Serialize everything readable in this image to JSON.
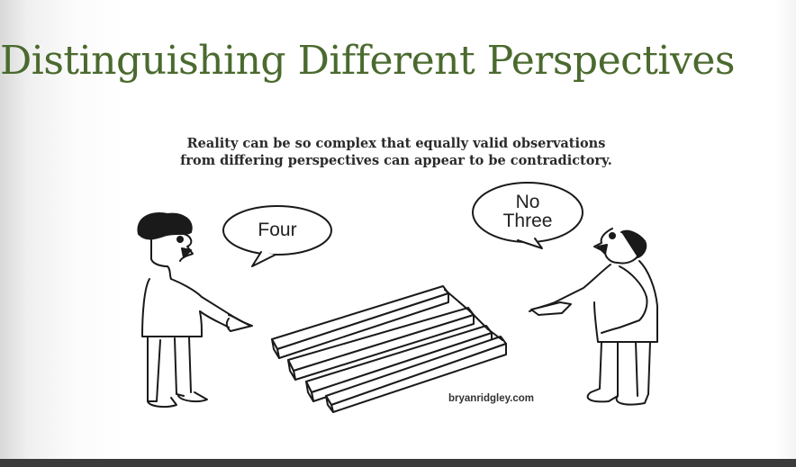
{
  "slide": {
    "title": "Distinguishing Different Perspectives"
  },
  "cartoon": {
    "caption_line1": "Reality can be so complex that equally valid observations",
    "caption_line2": "from differing perspectives can appear to be contradictory.",
    "left_speech": "Four",
    "right_speech_line1": "No",
    "right_speech_line2": "Three",
    "credit": "bryanridgley.com"
  }
}
